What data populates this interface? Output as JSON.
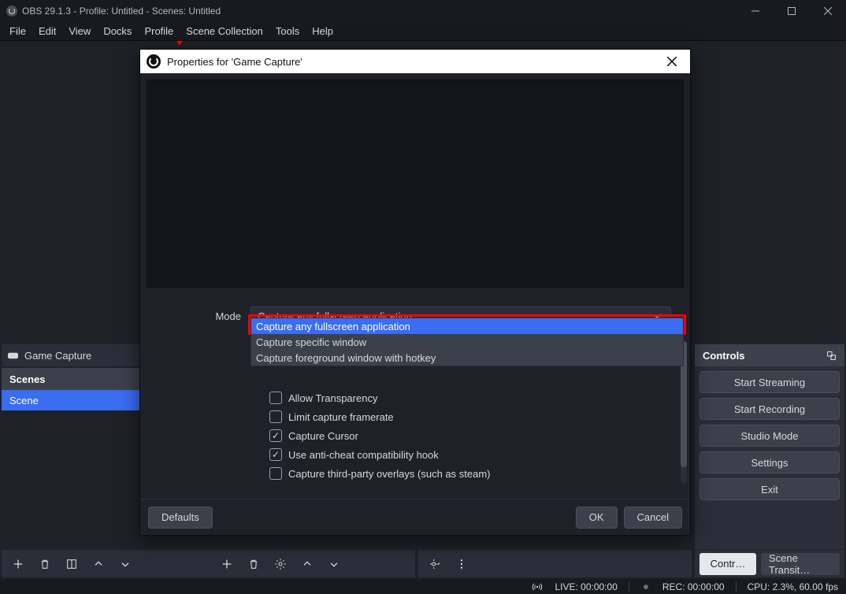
{
  "window": {
    "title": "OBS 29.1.3 - Profile: Untitled - Scenes: Untitled"
  },
  "menu": {
    "file": "File",
    "edit": "Edit",
    "view": "View",
    "docks": "Docks",
    "profile": "Profile",
    "scene_collection": "Scene Collection",
    "tools": "Tools",
    "help": "Help"
  },
  "sources": {
    "item": "Game Capture"
  },
  "scenes": {
    "header": "Scenes",
    "item": "Scene"
  },
  "controls": {
    "header": "Controls",
    "start_streaming": "Start Streaming",
    "start_recording": "Start Recording",
    "studio_mode": "Studio Mode",
    "settings": "Settings",
    "exit": "Exit",
    "tab_controls": "Contr…",
    "tab_scene_transitions": "Scene Transit…"
  },
  "status": {
    "live": "LIVE: 00:00:00",
    "rec": "REC: 00:00:00",
    "cpu": "CPU: 2.3%, 60.00 fps"
  },
  "dialog": {
    "title": "Properties for 'Game Capture'",
    "mode_label": "Mode",
    "mode_value": "Capture any fullscreen application",
    "options": {
      "o1": "Capture any fullscreen application",
      "o2": "Capture specific window",
      "o3": "Capture foreground window with hotkey"
    },
    "allow_transparency": "Allow Transparency",
    "limit_framerate": "Limit capture framerate",
    "capture_cursor": "Capture Cursor",
    "anti_cheat": "Use anti-cheat compatibility hook",
    "third_party": "Capture third-party overlays (such as steam)",
    "defaults": "Defaults",
    "ok": "OK",
    "cancel": "Cancel"
  }
}
